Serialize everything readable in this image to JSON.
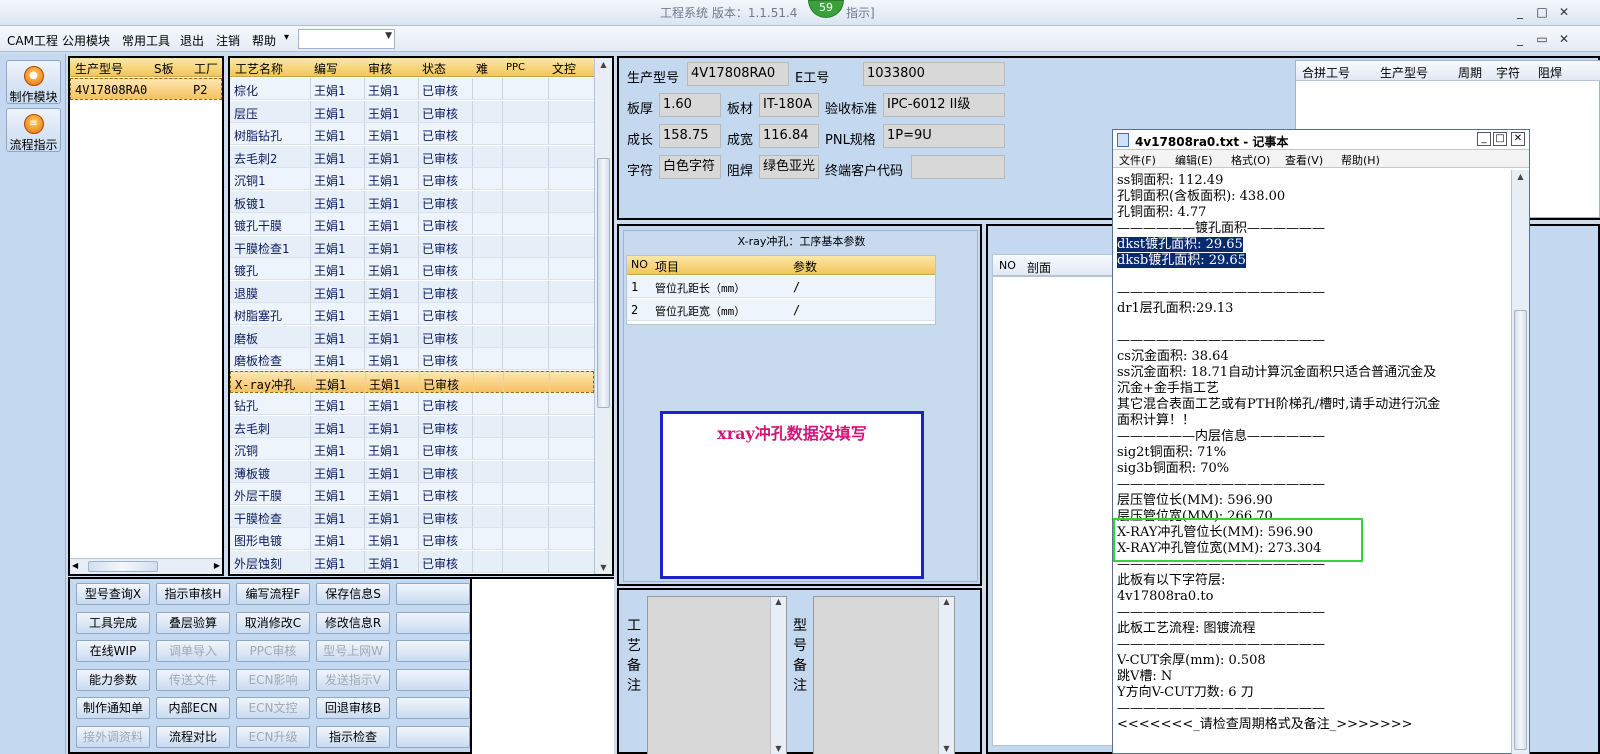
{
  "app": {
    "title": "工程系统  版本：1.1.51.4",
    "title_suffix": "指示]",
    "badge": "59"
  },
  "menu": {
    "items": [
      "CAM工程",
      "公用模块",
      "常用工具",
      "退出",
      "注销",
      "帮助"
    ],
    "dropdown_arrow": "▾",
    "combo_value": ""
  },
  "sidebar": {
    "items": [
      {
        "label": "制作模块",
        "icon": "gear-icon"
      },
      {
        "label": "流程指示",
        "icon": "flow-icon"
      }
    ]
  },
  "products": {
    "headers": [
      "生产型号",
      "S板",
      "工厂"
    ],
    "rows": [
      {
        "model": "4V17808RA0",
        "s": "",
        "factory": "P2"
      }
    ]
  },
  "process": {
    "headers": [
      "工艺名称",
      "编写",
      "审核",
      "状态",
      "难",
      "PPC",
      "文控"
    ],
    "rows": [
      [
        "棕化",
        "王娟1",
        "王娟1",
        "已审核"
      ],
      [
        "层压",
        "王娟1",
        "王娟1",
        "已审核"
      ],
      [
        "树脂钻孔",
        "王娟1",
        "王娟1",
        "已审核"
      ],
      [
        "去毛刺2",
        "王娟1",
        "王娟1",
        "已审核"
      ],
      [
        "沉铜1",
        "王娟1",
        "王娟1",
        "已审核"
      ],
      [
        "板镀1",
        "王娟1",
        "王娟1",
        "已审核"
      ],
      [
        "镀孔干膜",
        "王娟1",
        "王娟1",
        "已审核"
      ],
      [
        "干膜检查1",
        "王娟1",
        "王娟1",
        "已审核"
      ],
      [
        "镀孔",
        "王娟1",
        "王娟1",
        "已审核"
      ],
      [
        "退膜",
        "王娟1",
        "王娟1",
        "已审核"
      ],
      [
        "树脂塞孔",
        "王娟1",
        "王娟1",
        "已审核"
      ],
      [
        "磨板",
        "王娟1",
        "王娟1",
        "已审核"
      ],
      [
        "磨板检查",
        "王娟1",
        "王娟1",
        "已审核"
      ],
      [
        "X-ray冲孔",
        "王娟1",
        "王娟1",
        "已审核"
      ],
      [
        "钻孔",
        "王娟1",
        "王娟1",
        "已审核"
      ],
      [
        "去毛刺",
        "王娟1",
        "王娟1",
        "已审核"
      ],
      [
        "沉铜",
        "王娟1",
        "王娟1",
        "已审核"
      ],
      [
        "薄板镀",
        "王娟1",
        "王娟1",
        "已审核"
      ],
      [
        "外层干膜",
        "王娟1",
        "王娟1",
        "已审核"
      ],
      [
        "干膜检查",
        "王娟1",
        "王娟1",
        "已审核"
      ],
      [
        "图形电镀",
        "王娟1",
        "王娟1",
        "已审核"
      ],
      [
        "外层蚀刻",
        "王娟1",
        "王娟1",
        "已审核"
      ]
    ],
    "selected_index": 13
  },
  "buttons": {
    "rows": [
      [
        {
          "label": "型号查询X",
          "enabled": true
        },
        {
          "label": "指示审核H",
          "enabled": true
        },
        {
          "label": "编写流程F",
          "enabled": true
        },
        {
          "label": "保存信息S",
          "enabled": true
        },
        {
          "label": "",
          "enabled": true
        }
      ],
      [
        {
          "label": "工具完成",
          "enabled": true
        },
        {
          "label": "叠层验算",
          "enabled": true
        },
        {
          "label": "取消修改C",
          "enabled": true
        },
        {
          "label": "修改信息R",
          "enabled": true
        },
        {
          "label": "",
          "enabled": true
        }
      ],
      [
        {
          "label": "在线WIP",
          "enabled": true
        },
        {
          "label": "调单导入",
          "enabled": false
        },
        {
          "label": "PPC审核",
          "enabled": false
        },
        {
          "label": "型号上网W",
          "enabled": false
        },
        {
          "label": "",
          "enabled": true
        }
      ],
      [
        {
          "label": "能力参数",
          "enabled": true
        },
        {
          "label": "传送文件",
          "enabled": false
        },
        {
          "label": "ECN影响",
          "enabled": false
        },
        {
          "label": "发送指示V",
          "enabled": false
        },
        {
          "label": "",
          "enabled": true
        }
      ],
      [
        {
          "label": "制作通知单",
          "enabled": true
        },
        {
          "label": "内部ECN",
          "enabled": true
        },
        {
          "label": "ECN文控",
          "enabled": false
        },
        {
          "label": "回退审核B",
          "enabled": true
        },
        {
          "label": "",
          "enabled": true
        }
      ],
      [
        {
          "label": "接外调资料",
          "enabled": false
        },
        {
          "label": "流程对比",
          "enabled": true
        },
        {
          "label": "ECN升级",
          "enabled": false
        },
        {
          "label": "指示检查",
          "enabled": true
        },
        {
          "label": "",
          "enabled": true
        }
      ]
    ]
  },
  "info": {
    "model_label": "生产型号",
    "model": "4V17808RA0",
    "e_label": "E工号",
    "e_value": "1033800",
    "thick_label": "板厚",
    "thick": "1.60",
    "mat_label": "板材",
    "mat": "IT-180A",
    "std_label": "验收标准",
    "std": "IPC-6012 II级",
    "len_label": "成长",
    "len": "158.75",
    "wid_label": "成宽",
    "wid": "116.84",
    "pnl_label": "PNL规格",
    "pnl": "1P=9U",
    "char_label": "字符",
    "char": "白色字符",
    "mask_label": "阻焊",
    "mask": "绿色亚光",
    "cust_label": "终端客户代码",
    "cust": ""
  },
  "merge": {
    "headers": [
      "合拼工号",
      "生产型号",
      "周期",
      "字符",
      "阻焊"
    ]
  },
  "xray": {
    "title": "X-ray冲孔：工序基本参数",
    "headers": [
      "NO",
      "项目",
      "参数"
    ],
    "rows": [
      [
        "1",
        "管位孔距长（mm）",
        "/"
      ],
      [
        "2",
        "管位孔距宽（mm）",
        "/"
      ]
    ],
    "warning": "xray冲孔数据没填写"
  },
  "section": {
    "headers": [
      "NO",
      "剖面"
    ]
  },
  "remarks": {
    "process_label": "工艺备注",
    "model_label": "型号备注"
  },
  "notepad": {
    "title": "4v17808ra0.txt - 记事本",
    "menu": [
      "文件(F)",
      "编辑(E)",
      "格式(O)",
      "查看(V)",
      "帮助(H)"
    ],
    "lines": [
      "ss铜面积: 112.49",
      "孔铜面积(含板面积): 438.00",
      "孔铜面积: 4.77",
      "——————镀孔面积——————",
      "dkst镀孔面积: 29.65",
      "dksb镀孔面积: 29.65",
      "",
      "————————————————",
      "dr1层孔面积:29.13",
      "",
      "————————————————",
      "cs沉金面积: 38.64",
      "ss沉金面积: 18.71自动计算沉金面积只适合普通沉金及",
      "沉金+金手指工艺",
      "其它混合表面工艺或有PTH阶梯孔/槽时,请手动进行沉金",
      "面积计算！！",
      "——————内层信息——————",
      "sig2t铜面积: 71%",
      "sig3b铜面积: 70%",
      "————————————————",
      "层压管位长(MM): 596.90",
      "层压管位宽(MM): 266.70",
      "X-RAY冲孔管位长(MM): 596.90",
      "X-RAY冲孔管位宽(MM): 273.304",
      "————————————————",
      "此板有以下字符层:",
      "4v17808ra0.to",
      "————————————————",
      "此板工艺流程: 图镀流程",
      "————————————————",
      "V-CUT余厚(mm): 0.508",
      "跳V槽: N",
      "Y方向V-CUT刀数: 6 刀",
      "————————————————",
      "<<<<<<<_请检查周期格式及备注_>>>>>>>"
    ]
  }
}
